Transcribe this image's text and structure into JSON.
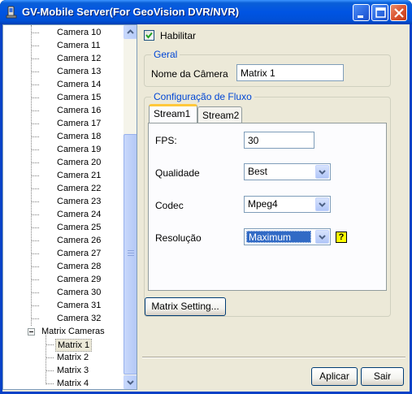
{
  "window": {
    "title": "GV-Mobile Server(For GeoVision DVR/NVR)"
  },
  "tree": {
    "cameras": [
      "Camera 10",
      "Camera 11",
      "Camera 12",
      "Camera 13",
      "Camera 14",
      "Camera 15",
      "Camera 16",
      "Camera 17",
      "Camera 18",
      "Camera 19",
      "Camera 20",
      "Camera 21",
      "Camera 22",
      "Camera 23",
      "Camera 24",
      "Camera 25",
      "Camera 26",
      "Camera 27",
      "Camera 28",
      "Camera 29",
      "Camera 30",
      "Camera 31",
      "Camera 32"
    ],
    "matrix_group": "Matrix Cameras",
    "matrices": [
      "Matrix 1",
      "Matrix 2",
      "Matrix 3",
      "Matrix 4"
    ],
    "selected": "Matrix 1"
  },
  "enable": {
    "label": "Habilitar",
    "checked": true
  },
  "general": {
    "title": "Geral",
    "camera_name_label": "Nome da Câmera",
    "camera_name_value": "Matrix 1"
  },
  "stream_config": {
    "title": "Configuração de Fluxo",
    "tabs": [
      "Stream1",
      "Stream2"
    ],
    "active_tab": "Stream1",
    "fps_label": "FPS:",
    "fps_value": "30",
    "quality_label": "Qualidade",
    "quality_value": "Best",
    "codec_label": "Codec",
    "codec_value": "Mpeg4",
    "resolution_label": "Resolução",
    "resolution_value": "Maximum",
    "help_glyph": "?"
  },
  "matrix_setting_label": "Matrix Setting...",
  "buttons": {
    "apply": "Aplicar",
    "exit": "Sair"
  },
  "colors": {
    "titlebar": "#0054e3",
    "group_title": "#0046d5",
    "selection": "#316ac5",
    "tab_highlight": "#ffc83c",
    "help_icon": "#ffff00"
  },
  "icons": {
    "app": "mobile-server-icon",
    "minimize": "minimize-icon",
    "maximize": "maximize-icon",
    "close": "close-icon",
    "checkbox": "checkmark-icon",
    "help": "help-icon",
    "dropdown": "chevron-down-icon"
  }
}
